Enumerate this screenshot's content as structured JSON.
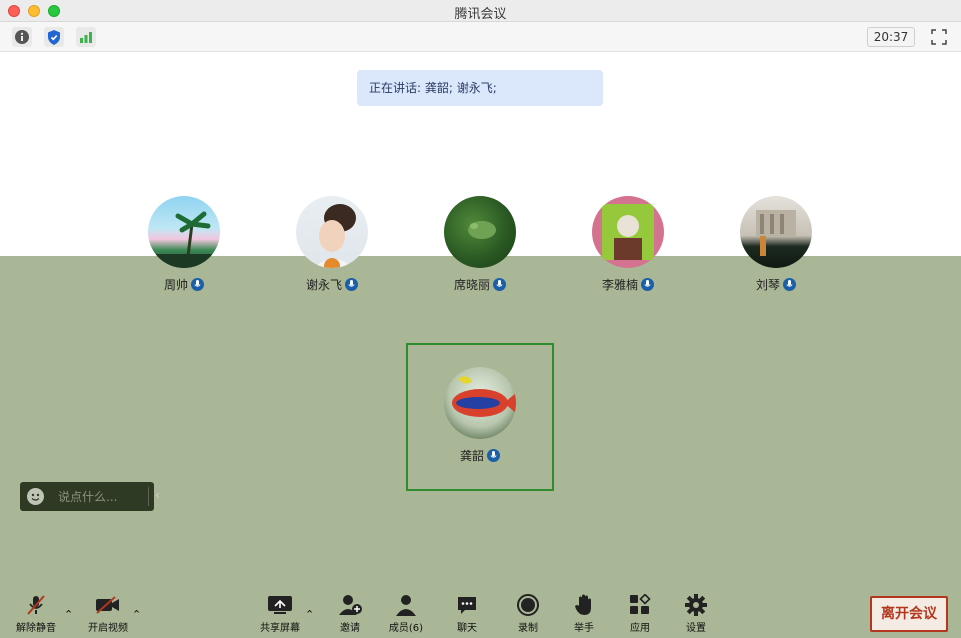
{
  "window": {
    "title": "腾讯会议"
  },
  "toolbar": {
    "time": "20:37"
  },
  "speaking": {
    "text": "正在讲话: 龚韶; 谢永飞;"
  },
  "participants": [
    {
      "name": "周帅"
    },
    {
      "name": "谢永飞"
    },
    {
      "name": "席晓丽"
    },
    {
      "name": "李雅楠"
    },
    {
      "name": "刘琴"
    }
  ],
  "main_speaker": {
    "name": "龚韶"
  },
  "chat": {
    "placeholder": "说点什么..."
  },
  "controls": {
    "unmute": "解除静音",
    "start_video": "开启视频",
    "share_screen": "共享屏幕",
    "invite": "邀请",
    "members": "成员(6)",
    "chat": "聊天",
    "record": "录制",
    "raise_hand": "举手",
    "apps": "应用",
    "settings": "设置",
    "leave": "离开会议"
  }
}
